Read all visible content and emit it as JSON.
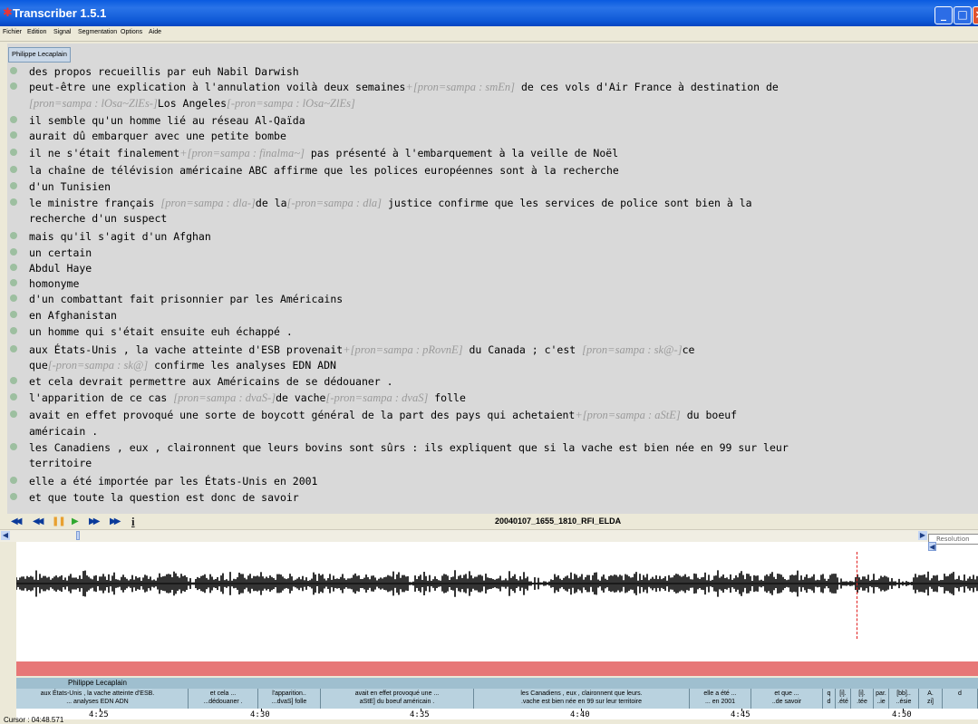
{
  "window": {
    "title": "Transcriber 1.5.1",
    "minimize": "_",
    "maximize": "□",
    "close": "×"
  },
  "menu": [
    "Fichier",
    "Edition",
    "Signal",
    "Segmentation",
    "Options",
    "Aide"
  ],
  "speaker": "Philippe Lecaplain",
  "segments": [
    [
      {
        "t": "des propos recueillis par euh Nabil Darwish"
      }
    ],
    [
      {
        "t": "peut-être une explication à l'annulation voilà deux semaines"
      },
      {
        "p": "+[pron=sampa : smEn]"
      },
      {
        "t": " de ces vols d'Air France à destination de"
      }
    ],
    [
      {
        "p": "[pron=sampa : lOsa~ZlEs-]"
      },
      {
        "t": "Los Angeles"
      },
      {
        "p": "[-pron=sampa : lOsa~ZlEs]"
      }
    ],
    [
      {
        "t": "il semble qu'un homme lié au réseau Al-Qaïda"
      }
    ],
    [
      {
        "t": "aurait dû embarquer avec une petite bombe"
      }
    ],
    [
      {
        "t": "il ne s'était finalement"
      },
      {
        "p": "+[pron=sampa : finalma~]"
      },
      {
        "t": " pas présenté à l'embarquement à la veille de Noël"
      }
    ],
    [
      {
        "t": "la chaîne de télévision américaine ABC affirme que les polices européennes sont à la recherche"
      }
    ],
    [
      {
        "t": "d'un Tunisien"
      }
    ],
    [
      {
        "t": "le ministre français "
      },
      {
        "p": "[pron=sampa : dla-]"
      },
      {
        "t": "de la"
      },
      {
        "p": "[-pron=sampa : dla]"
      },
      {
        "t": " justice confirme que les services de police sont bien à la"
      }
    ],
    [
      {
        "t": "recherche d'un suspect"
      }
    ],
    [
      {
        "t": "mais qu'il s'agit d'un Afghan"
      }
    ],
    [
      {
        "t": "un certain"
      }
    ],
    [
      {
        "t": "Abdul Haye"
      }
    ],
    [
      {
        "t": "homonyme"
      }
    ],
    [
      {
        "t": "d'un combattant fait prisonnier par les Américains"
      }
    ],
    [
      {
        "t": "en Afghanistan"
      }
    ],
    [
      {
        "t": "un homme qui s'était ensuite euh échappé ."
      }
    ],
    [
      {
        "t": "aux États-Unis , la vache atteinte d'ESB provenait"
      },
      {
        "p": "+[pron=sampa : pRovnE]"
      },
      {
        "t": " du Canada ; c'est "
      },
      {
        "p": "[pron=sampa : sk@-]"
      },
      {
        "t": "ce"
      }
    ],
    [
      {
        "t": "que"
      },
      {
        "p": "[-pron=sampa : sk@]"
      },
      {
        "t": " confirme les analyses EDN ADN"
      }
    ],
    [
      {
        "t": "et cela devrait permettre aux Américains de se dédouaner ."
      }
    ],
    [
      {
        "t": "l'apparition de ce cas "
      },
      {
        "p": "[pron=sampa : dvaS-]"
      },
      {
        "t": "de vache"
      },
      {
        "p": "[-pron=sampa : dvaS]"
      },
      {
        "t": " folle"
      }
    ],
    [
      {
        "t": "avait en effet provoqué une sorte de boycott général de la part des pays qui achetaient"
      },
      {
        "p": "+[pron=sampa : aStE]"
      },
      {
        "t": " du boeuf"
      }
    ],
    [
      {
        "t": "américain ."
      }
    ],
    [
      {
        "t": "les Canadiens , eux , claironnent que leurs bovins sont sûrs : ils expliquent que si la vache est bien née en 99 sur leur"
      }
    ],
    [
      {
        "t": "territoire"
      }
    ],
    [
      {
        "t": "elle a été importée par les États-Unis en 2001"
      }
    ],
    [
      {
        "t": "et que toute la question est donc de savoir"
      }
    ]
  ],
  "controls": {
    "rewind_start": "◀◀",
    "rewind": "◀◀",
    "pause": "❚❚",
    "play": "▶",
    "forward": "▶▶",
    "forward_end": "▶▶",
    "info": "i"
  },
  "filename": "20040107_1655_1810_RFI_ELDA",
  "resolution_label": "Resolution",
  "speaker_band": "Philippe Lecaplain",
  "timeline_segments": [
    {
      "l1": "aux États-Unis , la vache atteinte d'ESB.",
      "l2": "... analyses EDN ADN"
    },
    {
      "l1": "et cela ...",
      "l2": "...dédouaner ."
    },
    {
      "l1": "l'apparition..",
      "l2": "...dvaS] folle"
    },
    {
      "l1": "avait en effet provoqué une ...",
      "l2": "aStE] du boeuf américain ."
    },
    {
      "l1": "les Canadiens , eux , claironnent que leurs.",
      "l2": ".vache est bien née en 99 sur leur territoire"
    },
    {
      "l1": "elle a été ...",
      "l2": "... en 2001"
    },
    {
      "l1": "et que ...",
      "l2": "..de savoir"
    },
    {
      "l1": "q",
      "l2": "d"
    },
    {
      "l1": "[i].",
      "l2": ".été"
    },
    {
      "l1": "[i].",
      "l2": ".tée"
    },
    {
      "l1": "par.",
      "l2": "..ie"
    },
    {
      "l1": "[bb]..",
      "l2": "..ésie"
    },
    {
      "l1": "A.",
      "l2": "zi]"
    },
    {
      "l1": "d",
      "l2": ""
    }
  ],
  "time_ticks": [
    "4:25",
    "4:30",
    "4:35",
    "4:40",
    "4:45",
    "4:50"
  ],
  "cursor": "Cursor : 04:48.571",
  "colors": {
    "accent_blue": "#0A5BE0",
    "pron_gray": "#9A9A9A",
    "speaker_band": "#9FBFCF",
    "pink_band": "#E77777",
    "cursor_red": "#E02020"
  }
}
